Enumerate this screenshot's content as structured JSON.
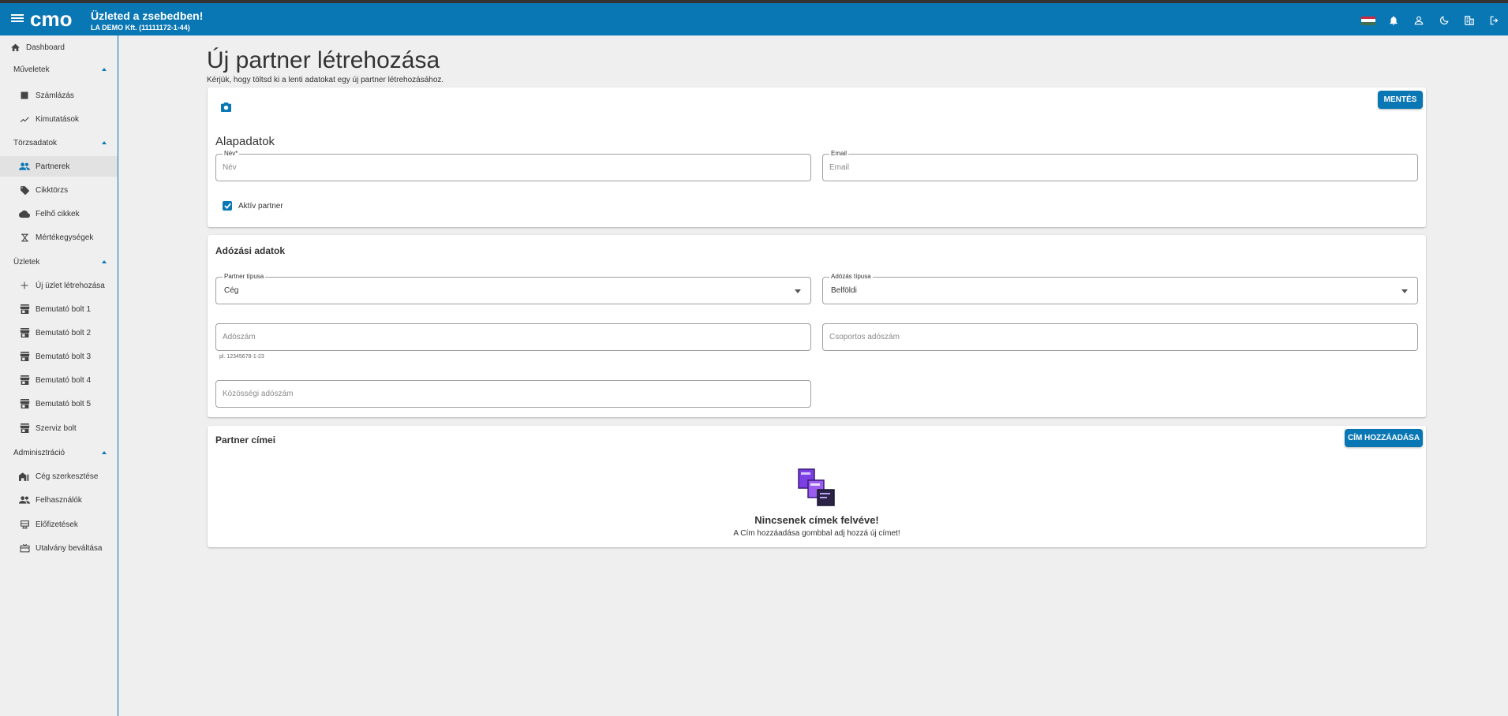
{
  "header": {
    "logo_text": "cmo",
    "title": "Üzleted a zsebedben!",
    "subtitle": "LA DEMO Kft. (11111172-1-44)",
    "icons": [
      "hungarian-flag-icon",
      "bell-icon",
      "user-icon",
      "dark-mode-icon",
      "company-icon",
      "logout-icon"
    ]
  },
  "sidebar": {
    "dashboard": "Dashboard",
    "sections": {
      "muveletek": "Műveletek",
      "torzsadatok": "Törzsadatok",
      "uzletek": "Üzletek",
      "adminisztracio": "Adminisztráció"
    },
    "items": {
      "szamlazas": "Számlázás",
      "kimutatasok": "Kimutatások",
      "partnerek": "Partnerek",
      "cikktorzs": "Cikktörzs",
      "felho_cikkek": "Felhő cikkek",
      "mertekegysegek": "Mértékegységek",
      "uj_uzlet": "Új üzlet létrehozása",
      "bolt1": "Bemutató bolt 1",
      "bolt2": "Bemutató bolt 2",
      "bolt3": "Bemutató bolt 3",
      "bolt4": "Bemutató bolt 4",
      "bolt5": "Bemutató bolt 5",
      "szerviz": "Szerviz bolt",
      "ceg_szerkesztese": "Cég szerkesztése",
      "felhasznalok": "Felhasználók",
      "elofizetesek": "Előfizetések",
      "utalvany": "Utalvány beváltása"
    },
    "active": "partnerek"
  },
  "page": {
    "title": "Új partner létrehozása",
    "subtitle": "Kérjük, hogy töltsd ki a lenti adatokat egy új partner létrehozásához."
  },
  "basic": {
    "save_label": "MENTÉS",
    "section_title": "Alapadatok",
    "name_label": "Név*",
    "name_placeholder": "Név",
    "name_value": "",
    "email_label": "Email",
    "email_placeholder": "Email",
    "email_value": "",
    "active_label": "Aktív partner",
    "active_checked": true
  },
  "tax": {
    "section_title": "Adózási adatok",
    "partner_type_label": "Partner típusa",
    "partner_type_value": "Cég",
    "tax_type_label": "Adózás típusa",
    "tax_type_value": "Belföldi",
    "tax_number_placeholder": "Adószám",
    "tax_number_value": "",
    "tax_number_helper": "pl. 12345678-1-23",
    "group_tax_placeholder": "Csoportos adószám",
    "group_tax_value": "",
    "community_tax_placeholder": "Közösségi adószám",
    "community_tax_value": ""
  },
  "addresses": {
    "section_title": "Partner címei",
    "add_label": "CÍM HOZZÁADÁSA",
    "empty_title": "Nincsenek címek felvéve!",
    "empty_text": "A Cím hozzáadása gombbal adj hozzá új címet!"
  },
  "colors": {
    "primary": "#0a77b5",
    "background": "#efefef",
    "empty_illustration": "#7b3fe4"
  }
}
